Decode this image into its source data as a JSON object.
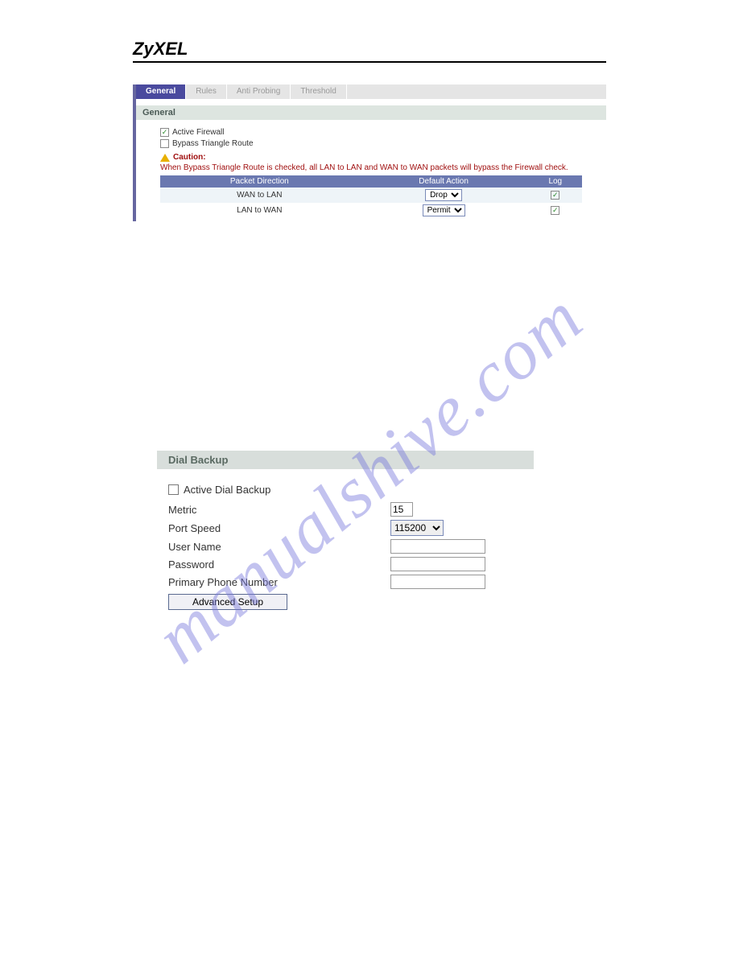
{
  "brand": "ZyXEL",
  "watermark": "manualshive.com",
  "firewall": {
    "tabs": [
      "General",
      "Rules",
      "Anti Probing",
      "Threshold"
    ],
    "section_title": "General",
    "active_firewall_label": "Active Firewall",
    "bypass_label": "Bypass Triangle Route",
    "caution_label": "Caution:",
    "caution_text": "When Bypass Triangle Route is checked, all LAN to LAN and WAN to WAN packets will bypass the Firewall check.",
    "columns": [
      "Packet Direction",
      "Default Action",
      "Log"
    ],
    "rows": [
      {
        "dir": "WAN to LAN",
        "action": "Drop",
        "log": true
      },
      {
        "dir": "LAN to WAN",
        "action": "Permit",
        "log": true
      }
    ]
  },
  "dial": {
    "section_title": "Dial Backup",
    "active_label": "Active Dial Backup",
    "metric_label": "Metric",
    "metric_value": "15",
    "port_speed_label": "Port Speed",
    "port_speed_value": "115200",
    "user_name_label": "User Name",
    "user_name_value": "",
    "password_label": "Password",
    "password_value": "",
    "phone_label": "Primary Phone Number",
    "phone_value": "",
    "advanced_label": "Advanced Setup"
  }
}
